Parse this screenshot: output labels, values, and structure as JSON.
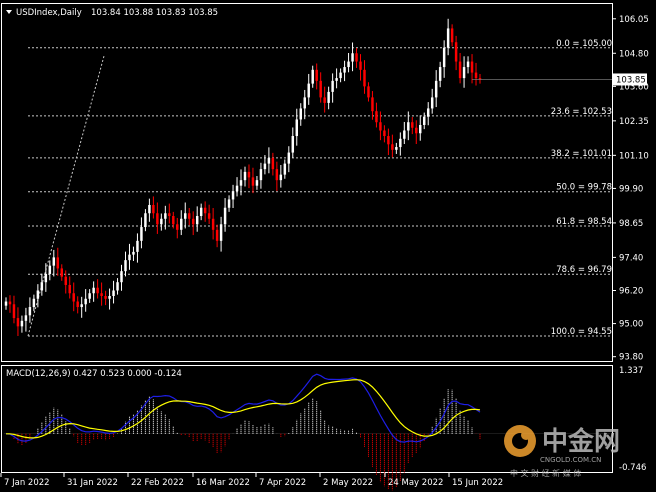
{
  "header": {
    "symbol_line": "USDIndex,Daily",
    "ohlc": "103.84 103.88 103.83 103.85"
  },
  "macd_header": "MACD(12,26,9) 0.427 0.523 0.000 -0.124",
  "colors": {
    "background": "#000000",
    "axis_frame": "#ffffff",
    "bull_candle": "#ffffff",
    "bear_candle": "#ff0000",
    "fib_line": "#c8c8c8",
    "macd_line": "#1e1ee6",
    "signal_line": "#ffff00",
    "macd_hist_pos": "#ffffff",
    "macd_hist_neg": "#ff0000",
    "price_tag_bg": "#ffffff",
    "watermark_logo": "#f0a030"
  },
  "watermark": {
    "brand": "中金网",
    "site": "CNGOLD.COM.CN",
    "slogan": "中 文 财 经 新 媒 体"
  },
  "chart_data": [
    {
      "type": "candlestick",
      "title": "USDIndex,Daily",
      "ylim": [
        93.68,
        106.55
      ],
      "y_ticks": [
        {
          "label": "106.05",
          "value": 106.05
        },
        {
          "label": "104.80",
          "value": 104.8
        },
        {
          "label": "103.60",
          "value": 103.6
        },
        {
          "label": "102.35",
          "value": 102.35
        },
        {
          "label": "101.10",
          "value": 101.1
        },
        {
          "label": "99.90",
          "value": 99.9
        },
        {
          "label": "98.65",
          "value": 98.65
        },
        {
          "label": "97.40",
          "value": 97.4
        },
        {
          "label": "96.20",
          "value": 96.2
        },
        {
          "label": "95.00",
          "value": 95.0
        },
        {
          "label": "93.80",
          "value": 93.8
        }
      ],
      "x_ticks": [
        "7 Jan 2022",
        "31 Jan 2022",
        "22 Feb 2022",
        "16 Mar 2022",
        "7 Apr 2022",
        "2 May 2022",
        "24 May 2022",
        "15 Jun 2022"
      ],
      "current_price": {
        "label": "103.85",
        "value": 103.85
      },
      "fibonacci": [
        {
          "label": "0.0 = 105.00",
          "level": 0.0,
          "value": 105.0
        },
        {
          "label": "23.6 = 102.53",
          "level": 23.6,
          "value": 102.53
        },
        {
          "label": "38.2 = 101.01",
          "level": 38.2,
          "value": 101.01
        },
        {
          "label": "50.0 = 99.78",
          "level": 50.0,
          "value": 99.78
        },
        {
          "label": "61.8 = 98.54",
          "level": 61.8,
          "value": 98.54
        },
        {
          "label": "78.6 = 96.79",
          "level": 78.6,
          "value": 96.79
        },
        {
          "label": "100.0 = 94.55",
          "level": 100.0,
          "value": 94.55
        }
      ],
      "close_path": [
        95.8,
        95.7,
        95.2,
        94.9,
        95.1,
        95.3,
        95.6,
        95.9,
        96.2,
        96.5,
        96.8,
        97.1,
        97.4,
        97.0,
        96.7,
        96.4,
        96.1,
        95.8,
        95.6,
        95.7,
        95.9,
        96.1,
        96.3,
        96.1,
        96.0,
        95.9,
        96.0,
        96.2,
        96.5,
        96.9,
        97.3,
        97.5,
        97.6,
        98.0,
        98.5,
        99.0,
        99.3,
        99.0,
        98.6,
        98.8,
        99.0,
        98.9,
        98.6,
        98.4,
        98.8,
        99.0,
        98.8,
        98.6,
        98.9,
        99.2,
        99.0,
        98.8,
        98.4,
        98.0,
        98.6,
        99.2,
        99.5,
        99.8,
        100.0,
        100.2,
        100.5,
        100.3,
        100.0,
        100.2,
        100.6,
        100.8,
        101.0,
        100.6,
        100.2,
        100.4,
        100.8,
        101.2,
        101.8,
        102.4,
        102.8,
        103.2,
        103.7,
        104.2,
        103.8,
        103.2,
        103.0,
        103.4,
        103.8,
        103.9,
        104.1,
        104.3,
        104.5,
        104.8,
        104.5,
        104.2,
        103.6,
        103.2,
        102.7,
        102.3,
        102.0,
        101.8,
        101.5,
        101.3,
        101.4,
        101.7,
        102.0,
        102.3,
        102.1,
        101.9,
        102.2,
        102.5,
        102.8,
        103.2,
        103.8,
        104.3,
        105.0,
        105.7,
        105.2,
        104.5,
        103.9,
        104.3,
        104.5,
        104.1,
        103.9,
        103.85
      ]
    },
    {
      "type": "macd",
      "title": "MACD(12,26,9)",
      "params": [
        12,
        26,
        9
      ],
      "values": {
        "macd": 0.427,
        "signal": 0.523,
        "third": 0.0,
        "fourth": -0.124
      },
      "ylim": [
        -0.746,
        1.337
      ],
      "y_ticks": [
        {
          "label": "1.337",
          "value": 1.337
        },
        {
          "label": "-0.746",
          "value": -0.746
        }
      ]
    }
  ]
}
